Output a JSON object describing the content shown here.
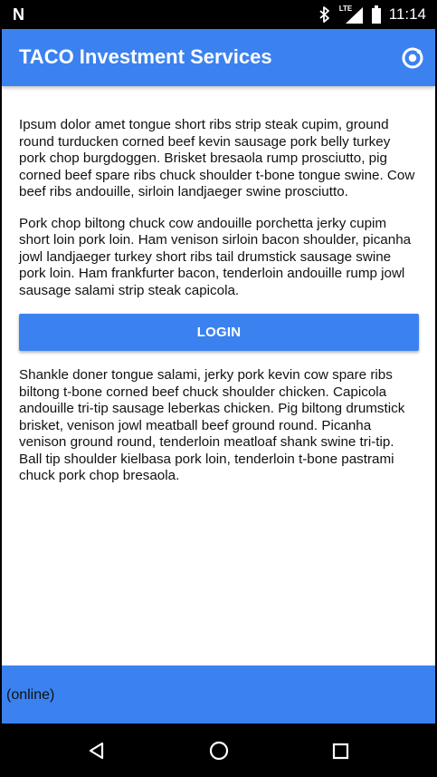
{
  "status_bar": {
    "notification_glyph": "N",
    "lte_label": "LTE",
    "time": "11:14",
    "icons": [
      "bluetooth-icon",
      "cellular-lte-icon",
      "battery-icon"
    ]
  },
  "header": {
    "title": "TACO Investment Services",
    "action_icon": "refresh-target-icon",
    "background": "#3b82f0"
  },
  "content": {
    "paragraphs": [
      "Ipsum dolor amet tongue short ribs strip steak cupim, ground round turducken corned beef kevin sausage pork belly turkey pork chop burgdoggen. Brisket bresaola rump prosciutto, pig corned beef spare ribs chuck shoulder t-bone tongue swine. Cow beef ribs andouille, sirloin landjaeger swine prosciutto.",
      "Pork chop biltong chuck cow andouille porchetta jerky cupim short loin pork loin. Ham venison sirloin bacon shoulder, picanha jowl landjaeger turkey short ribs tail drumstick sausage swine pork loin. Ham frankfurter bacon, tenderloin andouille rump jowl sausage salami strip steak capicola.",
      "Shankle doner tongue salami, jerky pork kevin cow spare ribs biltong t-bone corned beef chuck shoulder chicken. Capicola andouille tri-tip sausage leberkas chicken. Pig biltong drumstick brisket, venison jowl meatball beef ground round. Picanha venison ground round, tenderloin meatloaf shank swine tri-tip. Ball tip shoulder kielbasa pork loin, tenderloin t-bone pastrami chuck pork chop bresaola."
    ],
    "login_label": "LOGIN"
  },
  "footer": {
    "status": "(online)"
  },
  "nav_bar": {
    "icons": [
      "back-icon",
      "home-icon",
      "recent-apps-icon"
    ]
  },
  "colors": {
    "accent": "#3b82f0",
    "text": "#111111",
    "system_bar": "#000000"
  }
}
